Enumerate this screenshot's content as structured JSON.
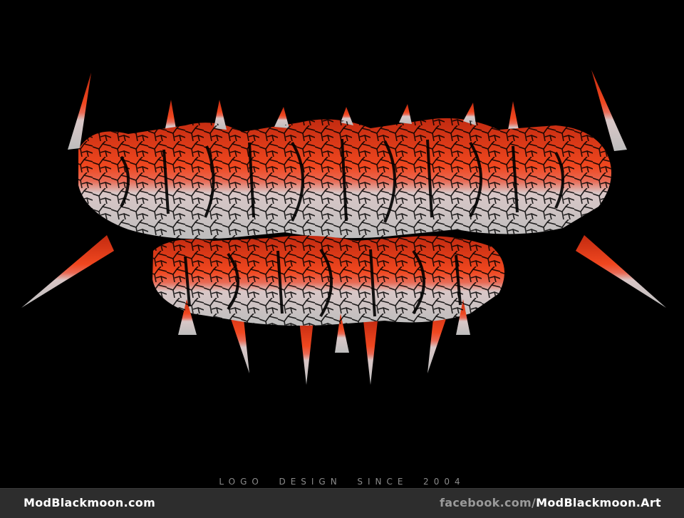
{
  "logo": {
    "description_icon": "band-logo-artwork",
    "top_color": "#e8401c",
    "bottom_color": "#d8d8d8"
  },
  "tagline": "LOGO  DESIGN  SINCE  2004",
  "footer": {
    "site": "ModBlackmoon.com",
    "social_prefix": "facebook.com/",
    "social_handle": "ModBlackmoon.Art"
  }
}
